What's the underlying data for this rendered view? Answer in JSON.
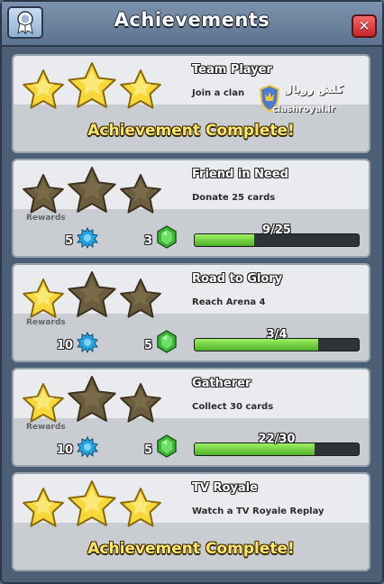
{
  "header": {
    "title": "Achievements",
    "close_label": "✕",
    "badge_icon": "ribbon-badge-icon"
  },
  "watermark": {
    "line1": "کلش رویال",
    "line2": "clashroyal.ir"
  },
  "common": {
    "rewards_label": "Rewards",
    "complete_label": "Achievement Complete!"
  },
  "achievements": [
    {
      "name": "Team Player",
      "description": "Join a clan",
      "stars_earned": 3,
      "completed": true
    },
    {
      "name": "Friend in Need",
      "description": "Donate 25 cards",
      "stars_earned": 0,
      "completed": false,
      "reward_xp": "5",
      "reward_gems": "3",
      "progress_text": "9/25",
      "progress_fraction": 0.36
    },
    {
      "name": "Road to Glory",
      "description": "Reach Arena 4",
      "stars_earned": 1,
      "completed": false,
      "reward_xp": "10",
      "reward_gems": "5",
      "progress_text": "3/4",
      "progress_fraction": 0.75
    },
    {
      "name": "Gatherer",
      "description": "Collect 30 cards",
      "stars_earned": 1,
      "completed": false,
      "reward_xp": "10",
      "reward_gems": "5",
      "progress_text": "22/30",
      "progress_fraction": 0.73
    },
    {
      "name": "TV Royale",
      "description": "Watch a TV Royale Replay",
      "stars_earned": 3,
      "completed": true
    }
  ],
  "colors": {
    "star_gold": "#f7d73a",
    "star_empty": "#6b5e3f",
    "progress_green": "#5fc332",
    "complete_yellow": "#fbe66b"
  }
}
